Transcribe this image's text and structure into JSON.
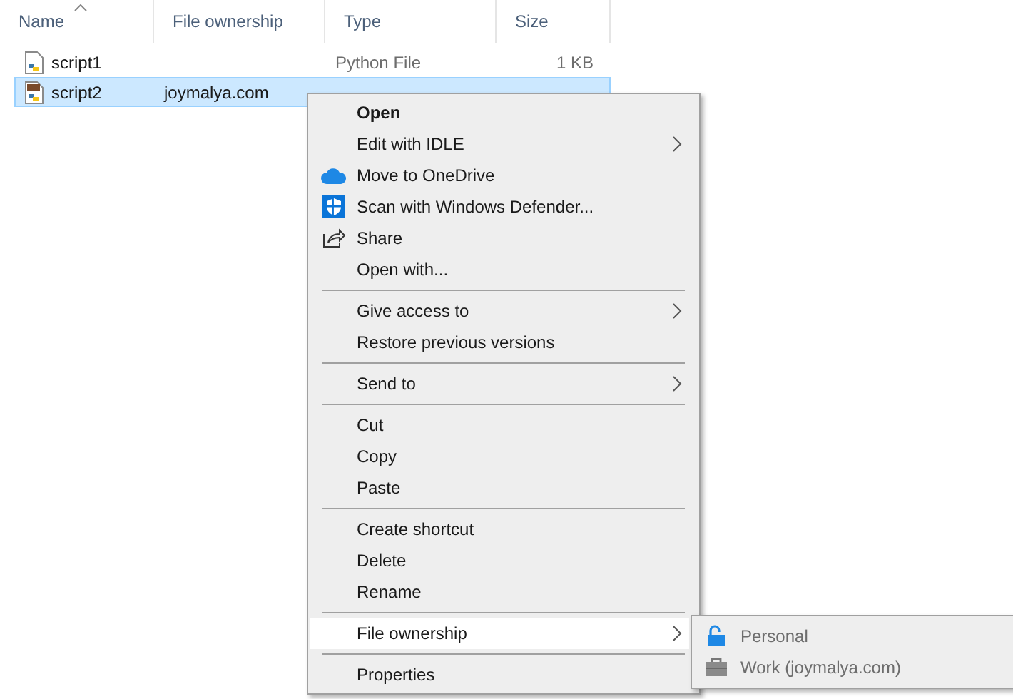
{
  "columns": [
    {
      "label": "Name",
      "sorted": true
    },
    {
      "label": "File ownership",
      "sorted": false
    },
    {
      "label": "Type",
      "sorted": false
    },
    {
      "label": "Size",
      "sorted": false
    }
  ],
  "files": [
    {
      "name": "script1",
      "type": "Python File",
      "size": "1 KB",
      "selected": false,
      "owned": false
    },
    {
      "name": "script2",
      "ownership": "joymalya.com",
      "selected": true,
      "owned": true
    }
  ],
  "context_menu": {
    "items": [
      {
        "kind": "item",
        "label": "Open",
        "default": true,
        "submenu": false,
        "selected": false
      },
      {
        "kind": "item",
        "label": "Edit with IDLE",
        "default": false,
        "submenu": true,
        "selected": false
      },
      {
        "kind": "item",
        "label": "Move to OneDrive",
        "default": false,
        "submenu": false,
        "selected": false
      },
      {
        "kind": "item",
        "label": "Scan with Windows Defender...",
        "default": false,
        "submenu": false,
        "selected": false
      },
      {
        "kind": "item",
        "label": "Share",
        "default": false,
        "submenu": false,
        "selected": false
      },
      {
        "kind": "item",
        "label": "Open with...",
        "default": false,
        "submenu": false,
        "selected": false
      },
      {
        "kind": "separator"
      },
      {
        "kind": "item",
        "label": "Give access to",
        "default": false,
        "submenu": true,
        "selected": false
      },
      {
        "kind": "item",
        "label": "Restore previous versions",
        "default": false,
        "submenu": false,
        "selected": false
      },
      {
        "kind": "separator"
      },
      {
        "kind": "item",
        "label": "Send to",
        "default": false,
        "submenu": true,
        "selected": false
      },
      {
        "kind": "separator"
      },
      {
        "kind": "item",
        "label": "Cut",
        "default": false,
        "submenu": false,
        "selected": false
      },
      {
        "kind": "item",
        "label": "Copy",
        "default": false,
        "submenu": false,
        "selected": false
      },
      {
        "kind": "item",
        "label": "Paste",
        "default": false,
        "submenu": false,
        "selected": false
      },
      {
        "kind": "separator"
      },
      {
        "kind": "item",
        "label": "Create shortcut",
        "default": false,
        "submenu": false,
        "selected": false
      },
      {
        "kind": "item",
        "label": "Delete",
        "default": false,
        "submenu": false,
        "selected": false
      },
      {
        "kind": "item",
        "label": "Rename",
        "default": false,
        "submenu": false,
        "selected": false
      },
      {
        "kind": "separator"
      },
      {
        "kind": "item",
        "label": "File ownership",
        "default": false,
        "submenu": true,
        "selected": true
      },
      {
        "kind": "separator"
      },
      {
        "kind": "item",
        "label": "Properties",
        "default": false,
        "submenu": false,
        "selected": false
      }
    ]
  },
  "submenu": {
    "items": [
      {
        "kind": "personal",
        "label": "Personal",
        "disabled": true
      },
      {
        "kind": "work",
        "label": "Work (joymalya.com)",
        "disabled": true
      }
    ]
  }
}
